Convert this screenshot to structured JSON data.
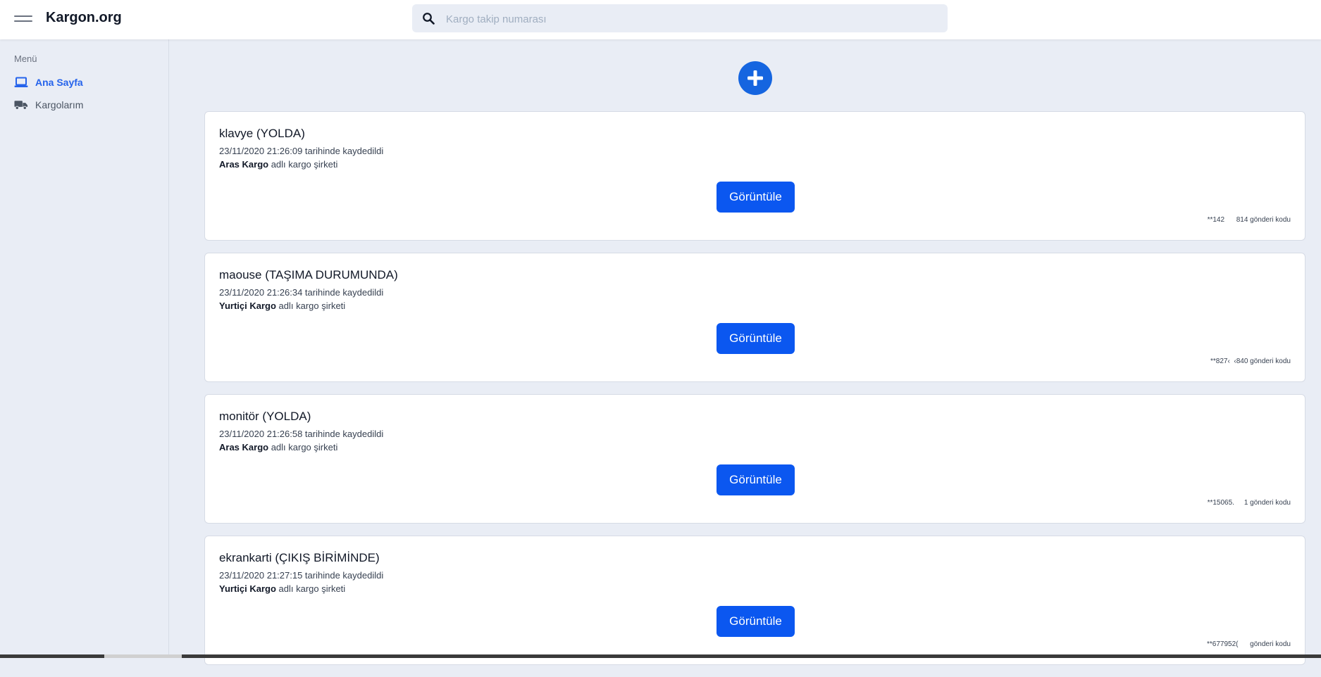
{
  "header": {
    "brand": "Kargon.org",
    "search": {
      "placeholder": "Kargo takip numarası",
      "value": ""
    }
  },
  "sidebar": {
    "menu_label": "Menü",
    "items": [
      {
        "label": "Ana Sayfa",
        "icon": "laptop-icon",
        "active": true
      },
      {
        "label": "Kargolarım",
        "icon": "truck-icon",
        "active": false
      }
    ]
  },
  "main": {
    "add_icon": "plus-icon",
    "cards": [
      {
        "title": "klavye (YOLDA)",
        "date_text": "23/11/2020 21:26:09 tarihinde kaydedildi",
        "company": "Aras Kargo",
        "company_suffix": " adlı kargo şirketi",
        "button_label": "Görüntüle",
        "code_text": "**142      814 gönderi kodu"
      },
      {
        "title": "maouse (TAŞIMA DURUMUNDA)",
        "date_text": "23/11/2020 21:26:34 tarihinde kaydedildi",
        "company": "Yurtiçi Kargo",
        "company_suffix": " adlı kargo şirketi",
        "button_label": "Görüntüle",
        "code_text": "**827‹  ‹840 gönderi kodu"
      },
      {
        "title": "monitör (YOLDA)",
        "date_text": "23/11/2020 21:26:58 tarihinde kaydedildi",
        "company": "Aras Kargo",
        "company_suffix": " adlı kargo şirketi",
        "button_label": "Görüntüle",
        "code_text": "**15065.     1 gönderi kodu"
      },
      {
        "title": "ekrankarti (ÇIKIŞ BİRİMİNDE)",
        "date_text": "23/11/2020 21:27:15 tarihinde kaydedildi",
        "company": "Yurtiçi Kargo",
        "company_suffix": " adlı kargo şirketi",
        "button_label": "Görüntüle",
        "code_text": "**677952(      gönderi kodu"
      }
    ]
  },
  "colors": {
    "accent": "#2563eb",
    "button": "#0b57f0",
    "background": "#e9edf5"
  }
}
